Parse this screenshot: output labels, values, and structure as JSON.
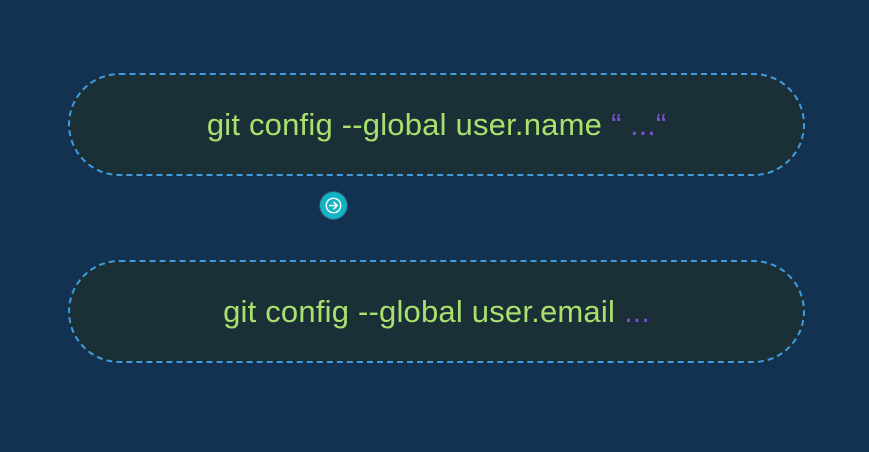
{
  "commands": [
    {
      "text": "git config --global user.name",
      "placeholder": "“ ...“"
    },
    {
      "text": "git config --global user.email",
      "placeholder": "..."
    }
  ],
  "colors": {
    "background": "#133150",
    "pill_fill": "#1b2f36",
    "pill_border": "#3f9ce0",
    "command_text": "#a9e06e",
    "placeholder_text": "#7a4fd0",
    "cursor_accent": "#14b3c4"
  },
  "icons": {
    "cursor": "arrow-right-circle-icon"
  }
}
